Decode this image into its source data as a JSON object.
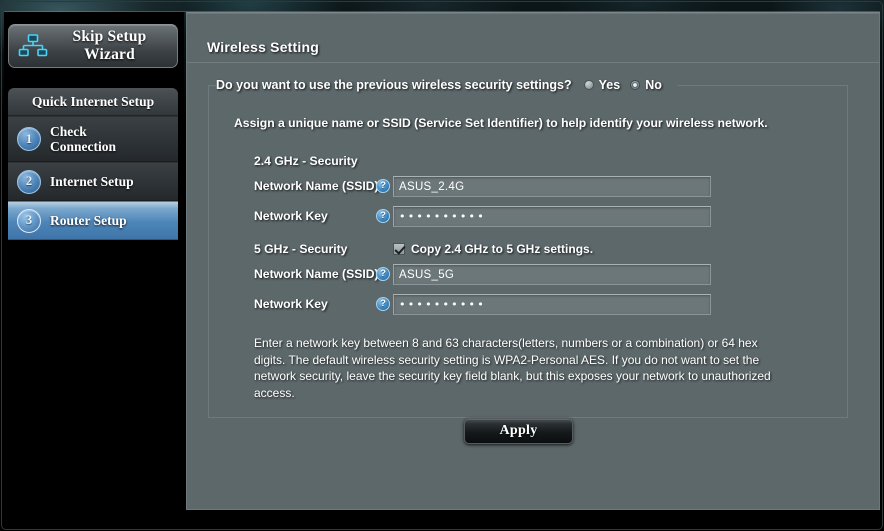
{
  "sidebar": {
    "skip_button": {
      "label": "Skip Setup Wizard",
      "icon": "network-topology-icon"
    },
    "section_title": "Quick Internet Setup",
    "steps": [
      {
        "number": "1",
        "label": "Check\nConnection",
        "active": false
      },
      {
        "number": "2",
        "label": "Internet Setup",
        "active": false
      },
      {
        "number": "3",
        "label": "Router Setup",
        "active": true
      }
    ]
  },
  "main": {
    "panel_title": "Wireless Setting",
    "prev_settings_question": "Do you want to use the previous wireless security settings?",
    "prev_settings_options": [
      {
        "label": "Yes",
        "selected": false
      },
      {
        "label": "No",
        "selected": true
      }
    ],
    "assign_note": "Assign a unique name or SSID (Service Set Identifier) to help identify your wireless network.",
    "bands": [
      {
        "heading": "2.4 GHz - Security",
        "ssid_label": "Network Name (SSID)",
        "ssid_value": "ASUS_2.4G",
        "key_label": "Network Key",
        "key_value": "••••••••••",
        "help_icon": "question-mark-icon"
      },
      {
        "heading": "5 GHz - Security",
        "ssid_label": "Network Name (SSID)",
        "ssid_value": "ASUS_5G",
        "key_label": "Network Key",
        "key_value": "••••••••••",
        "help_icon": "question-mark-icon"
      }
    ],
    "copy_checkbox": {
      "label": "Copy 2.4 GHz to 5 GHz settings.",
      "checked": true
    },
    "help_text": "Enter a network key between 8 and 63 characters(letters, numbers or a combination) or 64 hex digits. The default wireless security setting is WPA2-Personal AES. If you do not want to set the network security, leave the security key field blank, but this exposes your network to unauthorized access.",
    "apply_label": "Apply"
  },
  "colors": {
    "panel_bg": "#5d686b",
    "accent_blue": "#4d85b8",
    "help_icon_blue": "#3d88c4",
    "page_bg": "#000000"
  }
}
